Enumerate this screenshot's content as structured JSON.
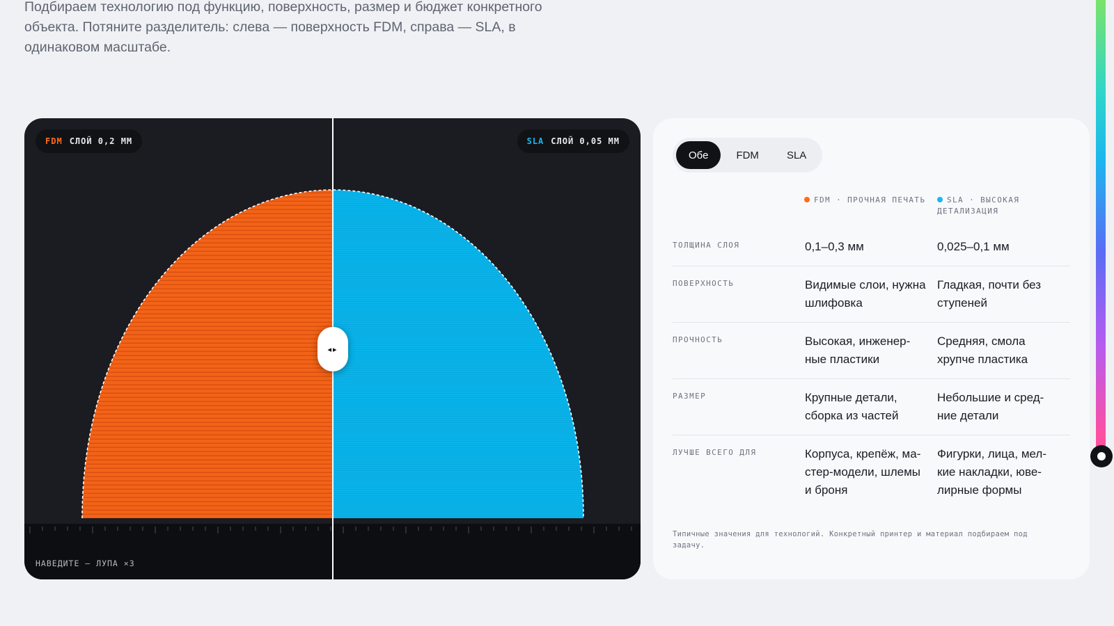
{
  "intro": {
    "text": "Подбираем технологию под функцию, поверхность, размер и бюджет конкретного объекта. Потяните разделитель: слева — поверхность FDM, справа — SLA, в одинаковом масштабе."
  },
  "viewer": {
    "left_pill": {
      "tag": "FDM",
      "text": "СЛОЙ 0,2 ММ"
    },
    "right_pill": {
      "tag": "SLA",
      "text": "СЛОЙ 0,05 ММ"
    },
    "hint": "НАВЕДИТЕ — ЛУПА ×3",
    "handle_glyph": "◂▸",
    "divider_position": 0.5,
    "colors": {
      "fdm": "#f26318",
      "sla": "#08b3ea",
      "background": "#1b1c22"
    }
  },
  "compare": {
    "tabs": [
      {
        "label": "Обе",
        "active": true
      },
      {
        "label": "FDM",
        "active": false
      },
      {
        "label": "SLA",
        "active": false
      }
    ],
    "legend": {
      "fdm": "FDM · ПРОЧНАЯ ПЕЧАТЬ",
      "sla": "SLA · ВЫСОКАЯ ДЕТАЛИЗАЦИЯ"
    },
    "rows": [
      {
        "label": "ТОЛЩИНА СЛОЯ",
        "fdm": "0,1–0,3 мм",
        "sla": "0,025–0,1 мм"
      },
      {
        "label": "ПОВЕРХНОСТЬ",
        "fdm": "Видимые слои, нужна шлифовка",
        "sla": "Гладкая, почти без ступеней"
      },
      {
        "label": "ПРОЧНОСТЬ",
        "fdm": "Высокая, инженер-ные пластики",
        "sla": "Средняя, смола хрупче пластика"
      },
      {
        "label": "РАЗМЕР",
        "fdm": "Крупные детали, сборка из частей",
        "sla": "Небольшие и сред-ние детали"
      },
      {
        "label": "ЛУЧШЕ ВСЕГО ДЛЯ",
        "fdm": "Корпуса, крепёж, ма-стер-модели, шлемы и броня",
        "sla": "Фигурки, лица, мел-кие накладки, юве-лирные формы"
      }
    ],
    "footnote": "Типичные значения для технологий. Конкретный принтер и материал подбираем под задачу."
  }
}
